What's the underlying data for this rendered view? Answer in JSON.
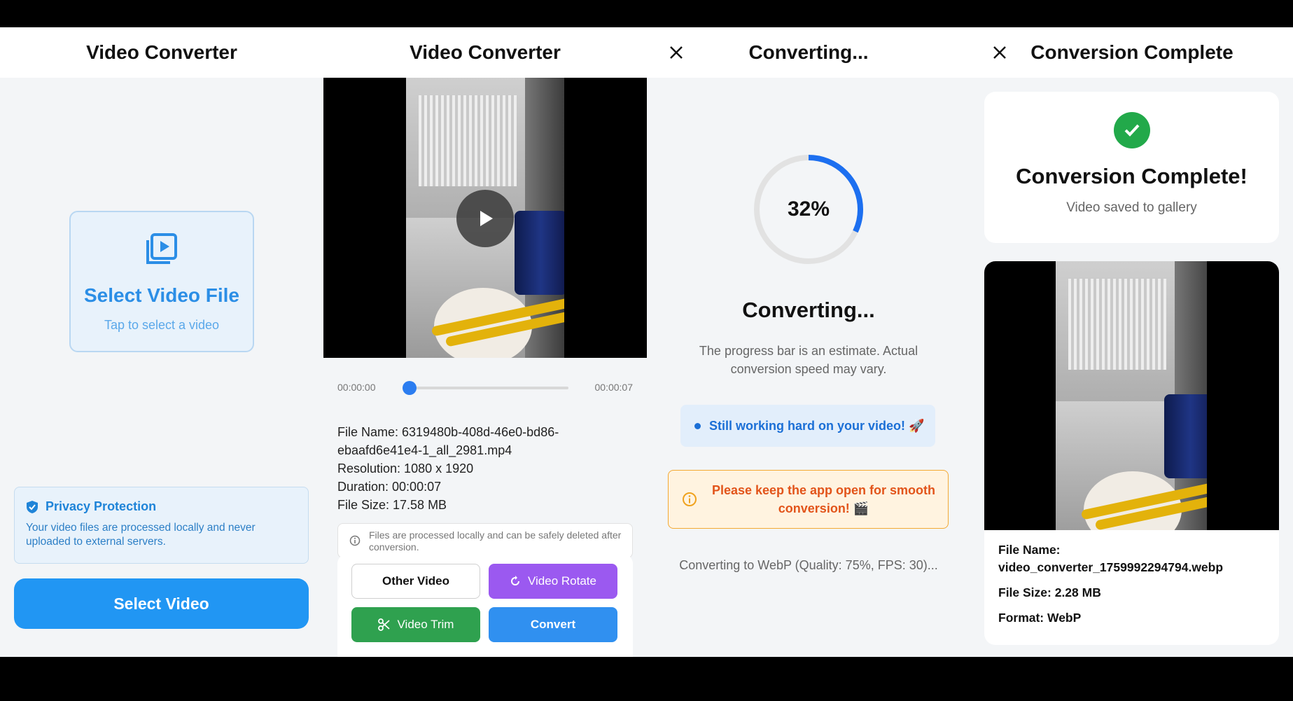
{
  "screens": {
    "select": {
      "title": "Video Converter",
      "card_title": "Select Video File",
      "card_hint": "Tap to select a video",
      "privacy_title": "Privacy Protection",
      "privacy_body": "Your video files are processed locally and never uploaded to external servers.",
      "button": "Select Video"
    },
    "preview": {
      "title": "Video Converter",
      "time_start": "00:00:00",
      "time_end": "00:00:07",
      "playback_progress": 0,
      "file_name": "File Name: 6319480b-408d-46e0-bd86-ebaafd6e41e4-1_all_2981.mp4",
      "resolution": "Resolution: 1080 x 1920",
      "duration": "Duration: 00:00:07",
      "file_size": "File Size: 17.58 MB",
      "note": "Files are processed locally and can be safely deleted after conversion.",
      "buttons": {
        "other": "Other Video",
        "rotate": "Video Rotate",
        "trim": "Video Trim",
        "convert": "Convert"
      }
    },
    "converting": {
      "title": "Converting...",
      "percent_label": "32%",
      "percent": 32,
      "heading": "Converting...",
      "note": "The progress bar is an estimate. Actual conversion speed may vary.",
      "working": "Still working hard on your video! 🚀",
      "warning": "Please keep the app open for smooth conversion! 🎬",
      "status": "Converting to WebP (Quality: 75%, FPS: 30)..."
    },
    "complete": {
      "title": "Conversion Complete",
      "heading": "Conversion Complete!",
      "subtitle": "Video saved to gallery",
      "file_name_label": "File Name:",
      "file_name": "video_converter_1759992294794.webp",
      "file_size": "File Size: 2.28 MB",
      "format": "Format: WebP"
    }
  },
  "colors": {
    "primary": "#2196f3",
    "rotate": "#9b59f0",
    "trim": "#2fa14f",
    "convert": "#3090f0",
    "success": "#22a94a",
    "warning": "#e2541a"
  }
}
